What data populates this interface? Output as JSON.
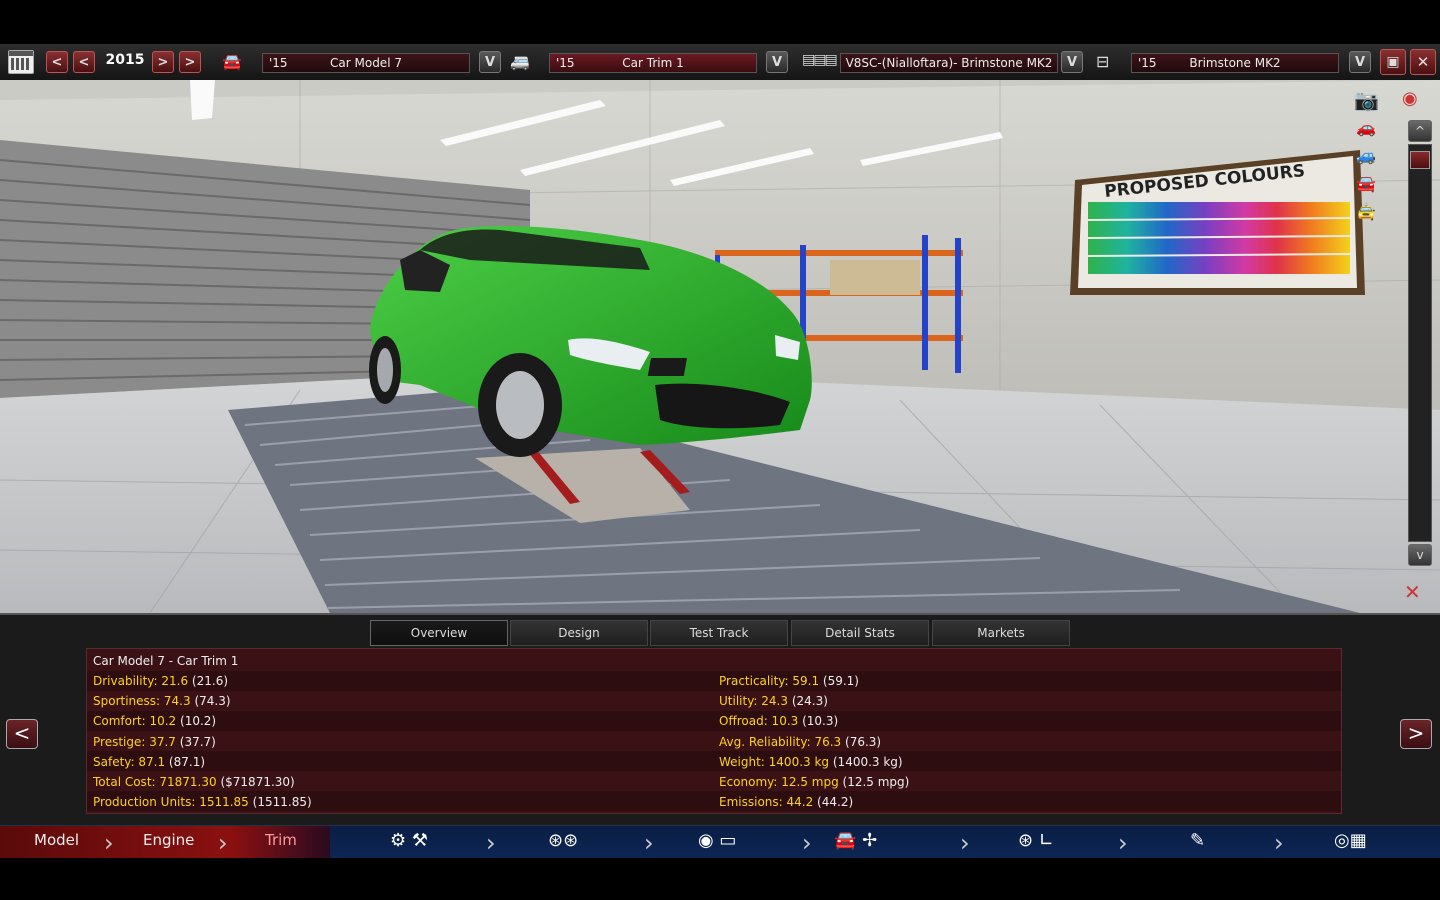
{
  "toolbar": {
    "year": "2015",
    "model": {
      "year": "'15",
      "name": "Car Model 7"
    },
    "trim": {
      "year": "'15",
      "name": "Car Trim 1"
    },
    "engine": {
      "name": "V8SC-(Nialloftara)- Brimstone MK2"
    },
    "family": {
      "year": "'15",
      "name": "Brimstone MK2"
    },
    "prev_label": "<",
    "next_label": ">",
    "dropdown_label": "V"
  },
  "scene": {
    "poster_title": "PROPOSED COLOURS",
    "car_color": "#1f9a22"
  },
  "tabs": [
    {
      "label": "Overview",
      "active": true
    },
    {
      "label": "Design"
    },
    {
      "label": "Test Track"
    },
    {
      "label": "Detail Stats"
    },
    {
      "label": "Markets"
    }
  ],
  "stats": {
    "title": "Car Model 7 - Car Trim 1",
    "left": [
      {
        "label": "Drivability: 21.6",
        "value": "(21.6)"
      },
      {
        "label": "Sportiness: 74.3",
        "value": "(74.3)"
      },
      {
        "label": "Comfort: 10.2",
        "value": "(10.2)"
      },
      {
        "label": "Prestige: 37.7",
        "value": "(37.7)"
      },
      {
        "label": "Safety: 87.1",
        "value": "(87.1)"
      },
      {
        "label": "Total Cost: 71871.30",
        "value": "($71871.30)"
      },
      {
        "label": "Production Units: 1511.85",
        "value": "(1511.85)"
      }
    ],
    "right": [
      {
        "label": "Practicality: 59.1",
        "value": "(59.1)"
      },
      {
        "label": "Utility: 24.3",
        "value": "(24.3)"
      },
      {
        "label": "Offroad: 10.3",
        "value": "(10.3)"
      },
      {
        "label": "Avg. Reliability: 76.3",
        "value": "(76.3)"
      },
      {
        "label": "Weight: 1400.3 kg",
        "value": "(1400.3 kg)"
      },
      {
        "label": "Economy: 12.5 mpg",
        "value": "(12.5 mpg)"
      },
      {
        "label": "Emissions: 44.2",
        "value": "(44.2)"
      }
    ]
  },
  "bottomnav": {
    "model": "Model",
    "engine": "Engine",
    "trim": "Trim"
  }
}
